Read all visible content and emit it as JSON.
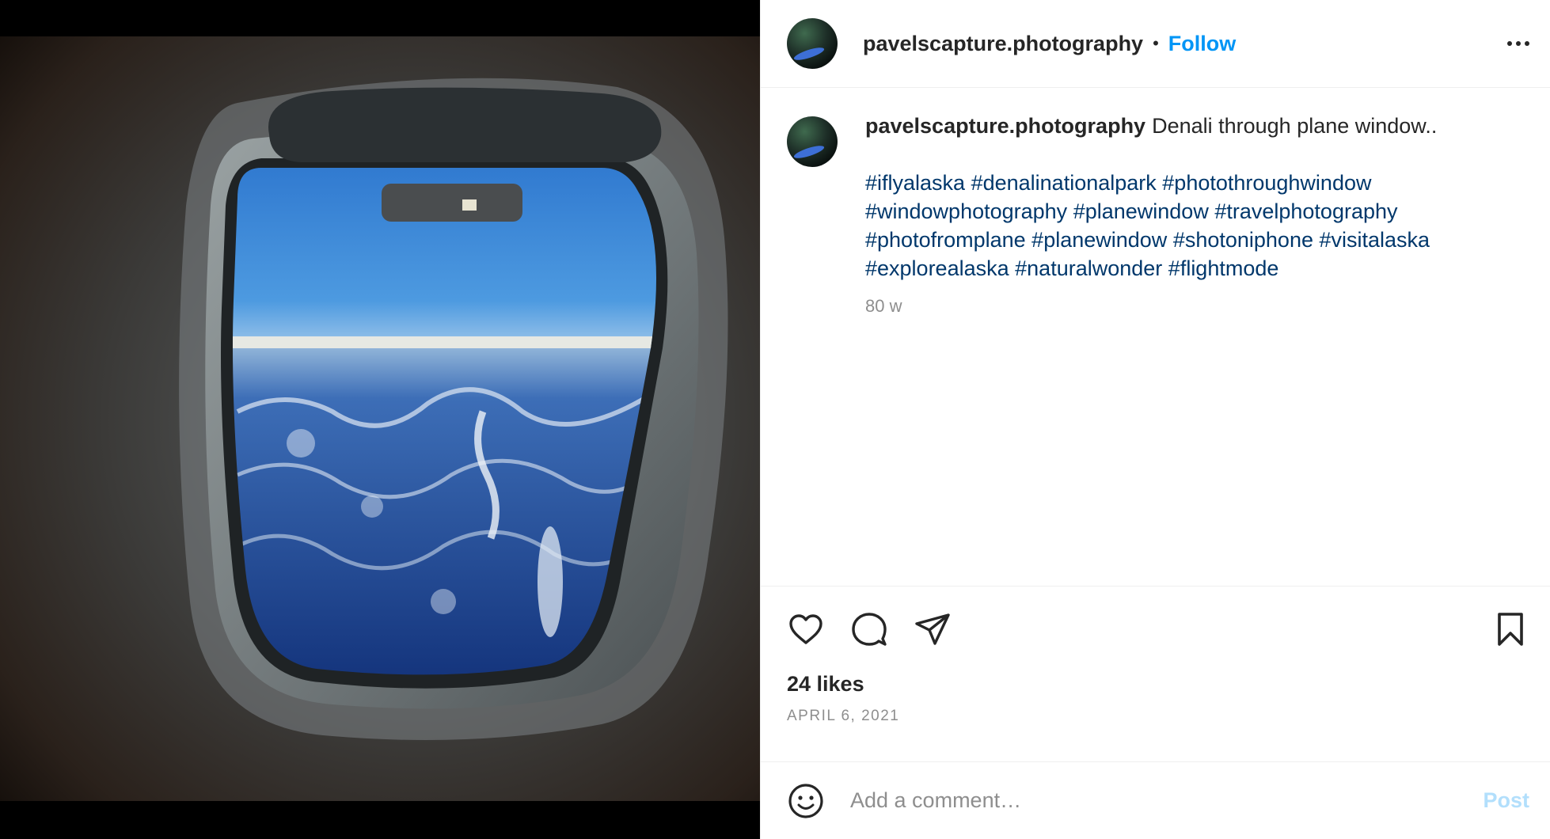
{
  "post": {
    "username": "pavelscapture.photography",
    "separator": "•",
    "follow_label": "Follow",
    "more_icon": "more-horizontal-icon",
    "image_alt": "Airplane window view of snowy Alaska mountains",
    "caption": {
      "username": "pavelscapture.photography",
      "text": "Denali through plane window..",
      "hashtags": [
        "#iflyalaska",
        "#denalinationalpark",
        "#photothroughwindow",
        "#windowphotography",
        "#planewindow",
        "#travelphotography",
        "#photofromplane",
        "#planewindow",
        "#shotoniphone",
        "#visitalaska",
        "#explorealaska",
        "#naturalwonder",
        "#flightmode"
      ],
      "age": "80 w"
    },
    "actions": {
      "like_icon": "heart-icon",
      "comment_icon": "comment-icon",
      "share_icon": "send-icon",
      "save_icon": "bookmark-icon"
    },
    "likes": "24 likes",
    "date": "APRIL 6, 2021",
    "comment_box": {
      "emoji_icon": "emoji-icon",
      "placeholder": "Add a comment…",
      "post_label": "Post"
    }
  },
  "colors": {
    "follow": "#0095f6",
    "hashtag": "#00376b",
    "muted": "#8e8e8e",
    "post_disabled": "#b2dffc"
  }
}
